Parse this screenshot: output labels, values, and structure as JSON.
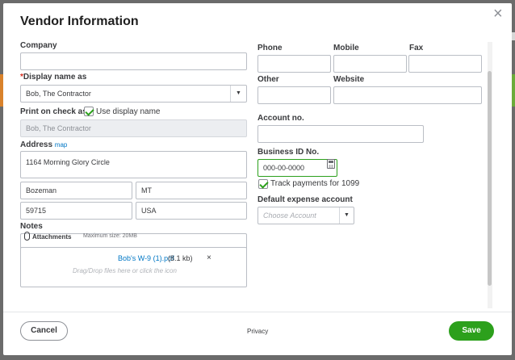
{
  "dialog": {
    "title": "Vendor Information",
    "close_symbol": "×"
  },
  "left": {
    "company_label": "Company",
    "company_value": "",
    "display_name_required": "*",
    "display_name_label": "Display name as",
    "display_name_value": "Bob, The Contractor",
    "print_on_check_label": "Print on check as",
    "use_display_name_label": "Use display name",
    "use_display_name_checked": true,
    "print_on_check_value": "Bob, The Contractor",
    "address_label": "Address",
    "address_map_link": "map",
    "street": "1164 Morning Glory Circle",
    "city": "Bozeman",
    "state": "MT",
    "zip": "59715",
    "country": "USA",
    "notes_label": "Notes",
    "notes_value": "",
    "attachments_label": "Attachments",
    "attachments_max": "Maximum size: 20MB",
    "attachment_file": "Bob's W-9 (1).pdf",
    "attachment_size": "(8.1 kb)",
    "attachment_remove": "×",
    "drop_hint": "Drag/Drop files here or click the icon"
  },
  "right": {
    "phone_label": "Phone",
    "mobile_label": "Mobile",
    "fax_label": "Fax",
    "other_label": "Other",
    "website_label": "Website",
    "account_no_label": "Account no.",
    "business_id_label": "Business ID No.",
    "business_id_value": "000-00-0000",
    "track_1099_label": "Track payments for 1099",
    "track_1099_checked": true,
    "default_expense_label": "Default expense account",
    "default_expense_placeholder": "Choose Account"
  },
  "footer": {
    "cancel_label": "Cancel",
    "privacy_label": "Privacy",
    "save_label": "Save"
  },
  "colors": {
    "primary_green": "#2ca01c",
    "link_blue": "#0077c5",
    "required_red": "#d52b1e"
  }
}
